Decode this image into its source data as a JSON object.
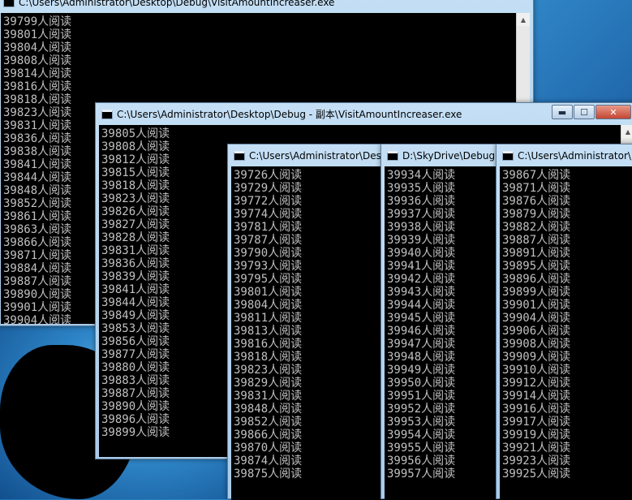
{
  "windows": {
    "w1": {
      "title": "C:\\Users\\Administrator\\Desktop\\Debug\\VisitAmountIncreaser.exe",
      "lines": [
        "39799人阅读",
        "39801人阅读",
        "39804人阅读",
        "39808人阅读",
        "39814人阅读",
        "39816人阅读",
        "39818人阅读",
        "39823人阅读",
        "39831人阅读",
        "39836人阅读",
        "39838人阅读",
        "39841人阅读",
        "39844人阅读",
        "39848人阅读",
        "39852人阅读",
        "39861人阅读",
        "39863人阅读",
        "39866人阅读",
        "39871人阅读",
        "39884人阅读",
        "39887人阅读",
        "39890人阅读",
        "39901人阅读",
        "39904人阅读"
      ]
    },
    "w2": {
      "title": "C:\\Users\\Administrator\\Desktop\\Debug - 副本\\VisitAmountIncreaser.exe",
      "lines": [
        "39805人阅读",
        "39808人阅读",
        "39812人阅读",
        "39815人阅读",
        "39818人阅读",
        "39823人阅读",
        "39826人阅读",
        "39827人阅读",
        "39828人阅读",
        "39831人阅读",
        "39836人阅读",
        "39839人阅读",
        "39841人阅读",
        "39844人阅读",
        "39849人阅读",
        "39853人阅读",
        "39856人阅读",
        "39877人阅读",
        "39880人阅读",
        "39883人阅读",
        "39887人阅读",
        "39890人阅读",
        "39896人阅读",
        "39899人阅读"
      ]
    },
    "w3": {
      "title": "C:\\Users\\Administrator\\Des",
      "lines": [
        "39726人阅读",
        "39729人阅读",
        "39772人阅读",
        "39774人阅读",
        "39781人阅读",
        "39787人阅读",
        "39790人阅读",
        "39793人阅读",
        "39795人阅读",
        "39801人阅读",
        "39804人阅读",
        "39811人阅读",
        "39813人阅读",
        "39816人阅读",
        "39818人阅读",
        "39823人阅读",
        "39829人阅读",
        "39831人阅读",
        "39848人阅读",
        "39852人阅读",
        "39866人阅读",
        "39870人阅读",
        "39874人阅读",
        "39875人阅读"
      ]
    },
    "w4": {
      "title": "D:\\SkyDrive\\Debug",
      "lines": [
        "39934人阅读",
        "39935人阅读",
        "39936人阅读",
        "39937人阅读",
        "39938人阅读",
        "39939人阅读",
        "39940人阅读",
        "39941人阅读",
        "39942人阅读",
        "39943人阅读",
        "39944人阅读",
        "39945人阅读",
        "39946人阅读",
        "39947人阅读",
        "39948人阅读",
        "39949人阅读",
        "39950人阅读",
        "39951人阅读",
        "39952人阅读",
        "39953人阅读",
        "39954人阅读",
        "39955人阅读",
        "39956人阅读",
        "39957人阅读"
      ]
    },
    "w5": {
      "title": "C:\\Users\\Administrator\\",
      "lines": [
        "39867人阅读",
        "39871人阅读",
        "39876人阅读",
        "39879人阅读",
        "39882人阅读",
        "39887人阅读",
        "39891人阅读",
        "39895人阅读",
        "39896人阅读",
        "39899人阅读",
        "39901人阅读",
        "39904人阅读",
        "39906人阅读",
        "39908人阅读",
        "39909人阅读",
        "39910人阅读",
        "39912人阅读",
        "39914人阅读",
        "39916人阅读",
        "39917人阅读",
        "39919人阅读",
        "39921人阅读",
        "39923人阅读",
        "39925人阅读"
      ]
    }
  },
  "caption": {
    "minimize": "▬",
    "maximize": "☐",
    "close": "✕"
  },
  "scroll": {
    "up": "▲"
  },
  "colors": {
    "console_bg": "#000000",
    "console_text": "#c0c0c0",
    "title_bar": "#b5d3ee"
  }
}
